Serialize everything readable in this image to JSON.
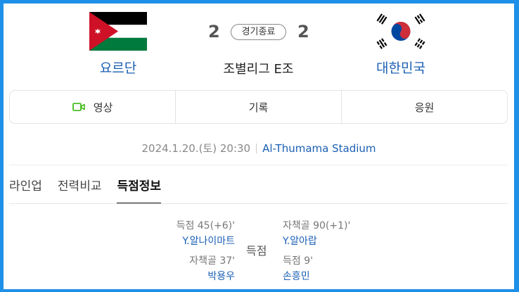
{
  "match": {
    "home": {
      "name": "요르단",
      "score": "2",
      "flag_colors": {
        "black": "#000000",
        "white": "#ffffff",
        "green": "#007a3d",
        "red": "#ce1126"
      }
    },
    "away": {
      "name": "대한민국",
      "score": "2",
      "flag_colors": {
        "red": "#cd2e3a",
        "blue": "#0047a0",
        "black": "#000000",
        "white": "#ffffff"
      }
    },
    "status": "경기종료",
    "league": "조별리그 E조"
  },
  "media_tabs": [
    {
      "label": "영상",
      "icon": "video-icon"
    },
    {
      "label": "기록"
    },
    {
      "label": "응원"
    }
  ],
  "info": {
    "date": "2024.1.20.(토) 20:30",
    "stadium": "Al-Thumama Stadium"
  },
  "sub_tabs": [
    {
      "label": "라인업"
    },
    {
      "label": "전력비교"
    },
    {
      "label": "득점정보",
      "active": true
    }
  ],
  "goals": {
    "center_label": "득점",
    "home": [
      {
        "minute": "득점 45(+6)'",
        "player": "Y.알나이마트"
      },
      {
        "minute": "자책골 37'",
        "player": "박용우"
      }
    ],
    "away": [
      {
        "minute": "자책골 90(+1)'",
        "player": "Y.알아랍"
      },
      {
        "minute": "득점 9'",
        "player": "손흥민"
      }
    ]
  },
  "colors": {
    "link_blue": "#1a5fb4",
    "frame_border": "#1e90e8",
    "video_icon_green": "#2db400"
  }
}
